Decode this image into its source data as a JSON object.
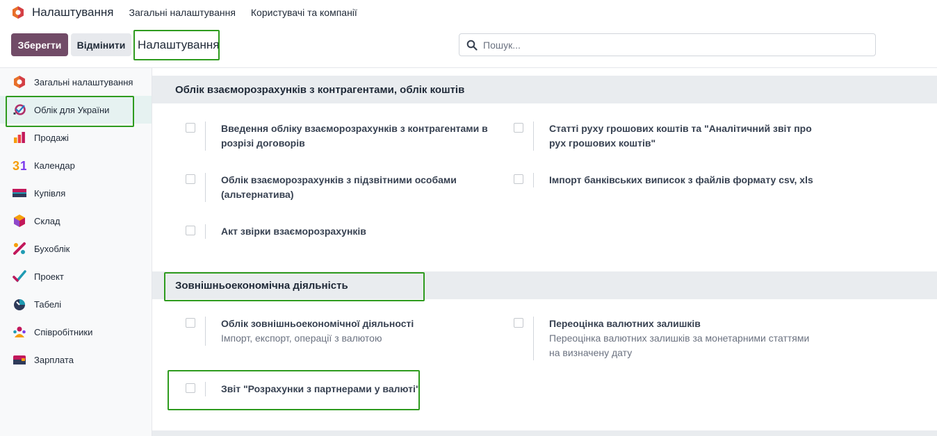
{
  "topbar": {
    "app_title": "Налаштування",
    "menu": [
      "Загальні налаштування",
      "Користувачі та компанії"
    ]
  },
  "control_panel": {
    "save_label": "Зберегти",
    "cancel_label": "Відмінити",
    "breadcrumb": "Налаштування",
    "search_placeholder": "Пошук..."
  },
  "sidebar": {
    "items": [
      {
        "label": "Загальні налаштування",
        "icon": "settings-app-icon"
      },
      {
        "label": "Облік для України",
        "icon": "ukraine-accounting-icon"
      },
      {
        "label": "Продажі",
        "icon": "sales-icon"
      },
      {
        "label": "Календар",
        "icon": "calendar-icon"
      },
      {
        "label": "Купівля",
        "icon": "purchase-icon"
      },
      {
        "label": "Склад",
        "icon": "inventory-icon"
      },
      {
        "label": "Бухоблік",
        "icon": "accounting-icon"
      },
      {
        "label": "Проект",
        "icon": "project-icon"
      },
      {
        "label": "Табелі",
        "icon": "timesheets-icon"
      },
      {
        "label": "Співробітники",
        "icon": "employees-icon"
      },
      {
        "label": "Зарплата",
        "icon": "payroll-icon"
      }
    ]
  },
  "sections": [
    {
      "title": "Облік взаєморозрахунків з контрагентами, облік коштів",
      "settings": [
        {
          "title": "Введення обліку взаєморозрахунків з контрагентами в розрізі договорів",
          "desc": "",
          "checked": false
        },
        {
          "title": "Статті руху грошових коштів та \"Аналітичний звіт про рух грошових коштів\"",
          "desc": "",
          "checked": false
        },
        {
          "title": "Облік взаєморозрахунків з підзвітними особами (альтернатива)",
          "desc": "",
          "checked": false
        },
        {
          "title": "Імпорт банківських виписок з файлів формату csv, xls",
          "desc": "",
          "checked": false
        },
        {
          "title": "Акт звірки взаєморозрахунків",
          "desc": "",
          "checked": false
        }
      ]
    },
    {
      "title": "Зовнішньоекономічна діяльність",
      "settings": [
        {
          "title": "Облік зовнішньоекономічної діяльності",
          "desc": "Імпорт, експорт, операції з валютою",
          "checked": false
        },
        {
          "title": "Переоцінка валютних залишків",
          "desc": "Переоцінка валютних залишків за монетарними статтями на визначену дату",
          "checked": false
        },
        {
          "title": "Звіт \"Розрахунки з партнерами у валюті\"",
          "desc": "",
          "checked": false
        }
      ]
    }
  ],
  "colors": {
    "brand": "#714b67",
    "highlight": "#2e9b1e",
    "section_bg": "#e9ecef",
    "active_item_bg": "#e6f2f1"
  }
}
